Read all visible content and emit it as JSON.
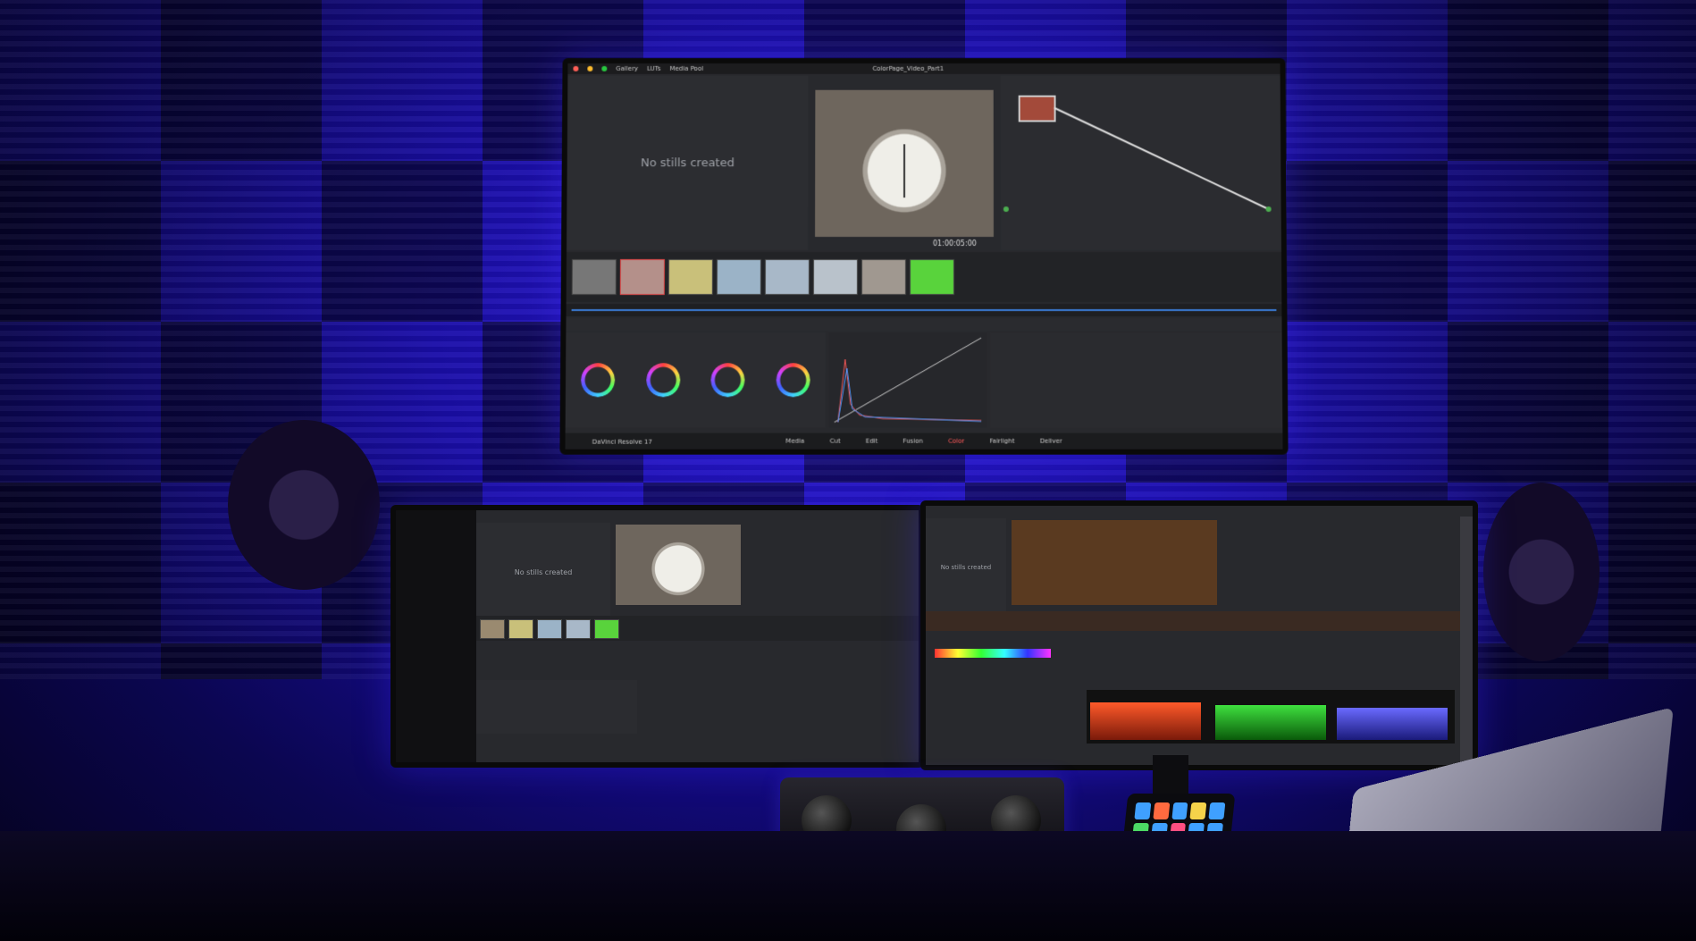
{
  "scene": {
    "wall_color": "#2414d0",
    "accent_light_color": "#3a2bff"
  },
  "top_monitor": {
    "app_menu": [
      "Gallery",
      "LUTs",
      "Media Pool"
    ],
    "window_title": "ColorPage_Video_Part1",
    "gallery_message": "No stills created",
    "timecode": "01:00:05:00",
    "pages": [
      "Media",
      "Cut",
      "Edit",
      "Fusion",
      "Color",
      "Fairlight",
      "Deliver"
    ],
    "project_label": "DaVinci Resolve 17"
  },
  "left_monitor": {
    "gallery_message": "No stills created"
  },
  "right_monitor": {
    "gallery_message": "No stills created"
  }
}
